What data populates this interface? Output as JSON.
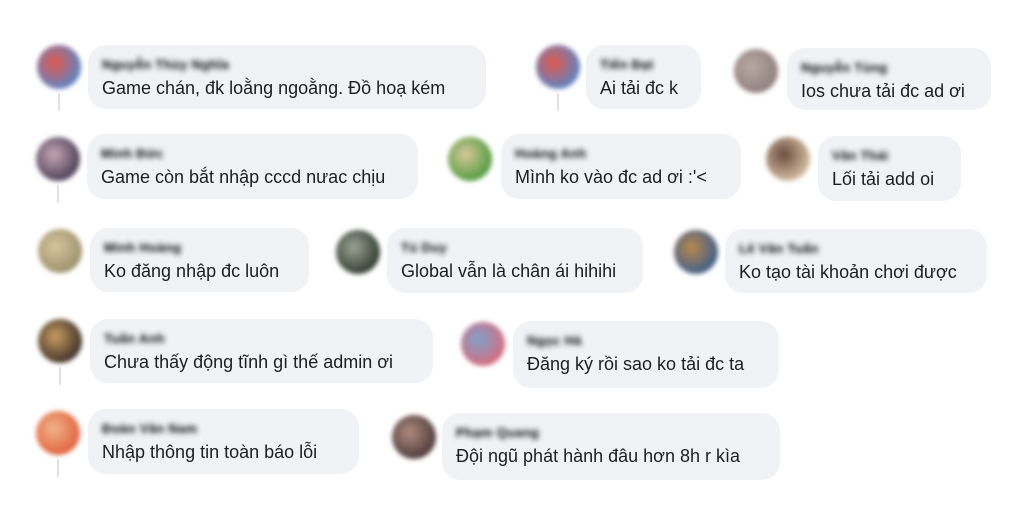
{
  "comments": [
    {
      "name": "Nguyễn Thùy Nghĩa",
      "text": "Game chán, đk loằng ngoằng. Đồ hoạ kém",
      "avatar_colors": [
        "#5b86c8",
        "#e0584d"
      ]
    },
    {
      "name": "Tiến Đạt",
      "text": "Ai tải đc k",
      "avatar_colors": [
        "#5b86c8",
        "#e0584d"
      ]
    },
    {
      "name": "Nguyễn Tùng",
      "text": "Ios chưa tải đc ad ơi",
      "avatar_colors": [
        "#8e7f7c",
        "#b9a9a3"
      ]
    },
    {
      "name": "Minh Đức",
      "text": "Game còn bắt nhập cccd nưac chịu",
      "avatar_colors": [
        "#4a3f55",
        "#c6a4b6"
      ]
    },
    {
      "name": "Hoàng Anh",
      "text": "Mình ko vào đc ad ơi :'<",
      "avatar_colors": [
        "#4f9a3e",
        "#d8c89a"
      ]
    },
    {
      "name": "Văn Thái",
      "text": "Lối tải add oi",
      "avatar_colors": [
        "#d8c2a6",
        "#6b4d3e"
      ]
    },
    {
      "name": "Minh Hoàng",
      "text": "Ko đăng nhập đc luôn",
      "avatar_colors": [
        "#9c8f6a",
        "#d6c6a0"
      ]
    },
    {
      "name": "Tú Duy",
      "text": "Global vẫn là chân ái hihihi",
      "avatar_colors": [
        "#2e3a2c",
        "#9aa497"
      ]
    },
    {
      "name": "Lê Văn Tuấn",
      "text": "Ko tạo tài khoản chơi được",
      "avatar_colors": [
        "#3c5e8a",
        "#b9874e"
      ]
    },
    {
      "name": "Tuấn Anh",
      "text": "Chưa thấy động tĩnh gì thế admin ơi",
      "avatar_colors": [
        "#3a2f28",
        "#c99b62"
      ]
    },
    {
      "name": "Ngọc Hà",
      "text": "Đăng ký rồi sao ko tải đc ta",
      "avatar_colors": [
        "#d96a7e",
        "#7fa2c9"
      ]
    },
    {
      "name": "Đoàn Văn Nam",
      "text": "Nhập thông tin toàn báo lỗi",
      "avatar_colors": [
        "#e0603c",
        "#f2b58a"
      ]
    },
    {
      "name": "Phạm Quang",
      "text": "Đội ngũ phát hành đâu hơn 8h r kìa",
      "avatar_colors": [
        "#4a3a3a",
        "#b08a7c"
      ]
    }
  ]
}
